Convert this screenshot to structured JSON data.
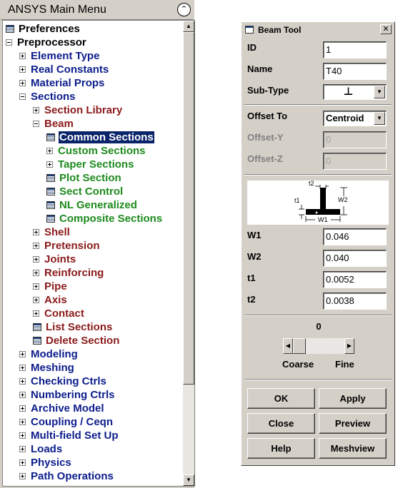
{
  "main_menu": {
    "title": "ANSYS Main Menu",
    "collapse_glyph": "⌃",
    "items": [
      {
        "label": "Preferences",
        "level": 0,
        "icon": "command",
        "color": "#000000"
      },
      {
        "label": "Preprocessor",
        "level": 0,
        "icon": "minus",
        "color": "#000000"
      },
      {
        "label": "Element Type",
        "level": 1,
        "icon": "plus",
        "color": "#0c1d8c"
      },
      {
        "label": "Real Constants",
        "level": 1,
        "icon": "plus",
        "color": "#0c1d8c"
      },
      {
        "label": "Material Props",
        "level": 1,
        "icon": "plus",
        "color": "#0c1d8c"
      },
      {
        "label": "Sections",
        "level": 1,
        "icon": "minus",
        "color": "#0c1d8c"
      },
      {
        "label": "Section Library",
        "level": 2,
        "icon": "plus",
        "color": "#8b1a1a"
      },
      {
        "label": "Beam",
        "level": 2,
        "icon": "minus",
        "color": "#8b1a1a"
      },
      {
        "label": "Common Sections",
        "level": 3,
        "icon": "command",
        "color": "#1d8a1d",
        "selected": true
      },
      {
        "label": "Custom Sections",
        "level": 3,
        "icon": "plus",
        "color": "#1d8a1d"
      },
      {
        "label": "Taper Sections",
        "level": 3,
        "icon": "plus",
        "color": "#1d8a1d"
      },
      {
        "label": "Plot Section",
        "level": 3,
        "icon": "command",
        "color": "#1d8a1d"
      },
      {
        "label": "Sect Control",
        "level": 3,
        "icon": "command",
        "color": "#1d8a1d"
      },
      {
        "label": "NL Generalized",
        "level": 3,
        "icon": "command",
        "color": "#1d8a1d"
      },
      {
        "label": "Composite Sections",
        "level": 3,
        "icon": "command",
        "color": "#1d8a1d"
      },
      {
        "label": "Shell",
        "level": 2,
        "icon": "plus",
        "color": "#8b1a1a"
      },
      {
        "label": "Pretension",
        "level": 2,
        "icon": "plus",
        "color": "#8b1a1a"
      },
      {
        "label": "Joints",
        "level": 2,
        "icon": "plus",
        "color": "#8b1a1a"
      },
      {
        "label": "Reinforcing",
        "level": 2,
        "icon": "plus",
        "color": "#8b1a1a"
      },
      {
        "label": "Pipe",
        "level": 2,
        "icon": "plus",
        "color": "#8b1a1a"
      },
      {
        "label": "Axis",
        "level": 2,
        "icon": "plus",
        "color": "#8b1a1a"
      },
      {
        "label": "Contact",
        "level": 2,
        "icon": "plus",
        "color": "#8b1a1a"
      },
      {
        "label": "List Sections",
        "level": 2,
        "icon": "command",
        "color": "#8b1a1a"
      },
      {
        "label": "Delete Section",
        "level": 2,
        "icon": "command",
        "color": "#8b1a1a"
      },
      {
        "label": "Modeling",
        "level": 1,
        "icon": "plus",
        "color": "#0c1d8c"
      },
      {
        "label": "Meshing",
        "level": 1,
        "icon": "plus",
        "color": "#0c1d8c"
      },
      {
        "label": "Checking Ctrls",
        "level": 1,
        "icon": "plus",
        "color": "#0c1d8c"
      },
      {
        "label": "Numbering Ctrls",
        "level": 1,
        "icon": "plus",
        "color": "#0c1d8c"
      },
      {
        "label": "Archive Model",
        "level": 1,
        "icon": "plus",
        "color": "#0c1d8c"
      },
      {
        "label": "Coupling / Ceqn",
        "level": 1,
        "icon": "plus",
        "color": "#0c1d8c"
      },
      {
        "label": "Multi-field Set Up",
        "level": 1,
        "icon": "plus",
        "color": "#0c1d8c"
      },
      {
        "label": "Loads",
        "level": 1,
        "icon": "plus",
        "color": "#0c1d8c"
      },
      {
        "label": "Physics",
        "level": 1,
        "icon": "plus",
        "color": "#0c1d8c"
      },
      {
        "label": "Path Operations",
        "level": 1,
        "icon": "plus",
        "color": "#0c1d8c"
      }
    ]
  },
  "beam_tool": {
    "title": "Beam Tool",
    "close_glyph": "✕",
    "id": {
      "label": "ID",
      "value": "1"
    },
    "name": {
      "label": "Name",
      "value": "T40"
    },
    "subtype": {
      "label": "Sub-Type",
      "value": "⊥"
    },
    "offset_to": {
      "label": "Offset To",
      "value": "Centroid"
    },
    "offset_y": {
      "label": "Offset-Y",
      "value": "0"
    },
    "offset_z": {
      "label": "Offset-Z",
      "value": "0"
    },
    "diagram": {
      "t2": "t2",
      "t1": "t1",
      "w1": "W1",
      "w2": "W2"
    },
    "w1": {
      "label": "W1",
      "value": "0.046"
    },
    "w2": {
      "label": "W2",
      "value": "0.040"
    },
    "t1": {
      "label": "t1",
      "value": "0.0052"
    },
    "t2": {
      "label": "t2",
      "value": "0.0038"
    },
    "mesh_size": {
      "value": "0",
      "coarse_label": "Coarse",
      "fine_label": "Fine"
    },
    "buttons": {
      "ok": "OK",
      "apply": "Apply",
      "close": "Close",
      "preview": "Preview",
      "help": "Help",
      "meshview": "Meshview"
    }
  }
}
